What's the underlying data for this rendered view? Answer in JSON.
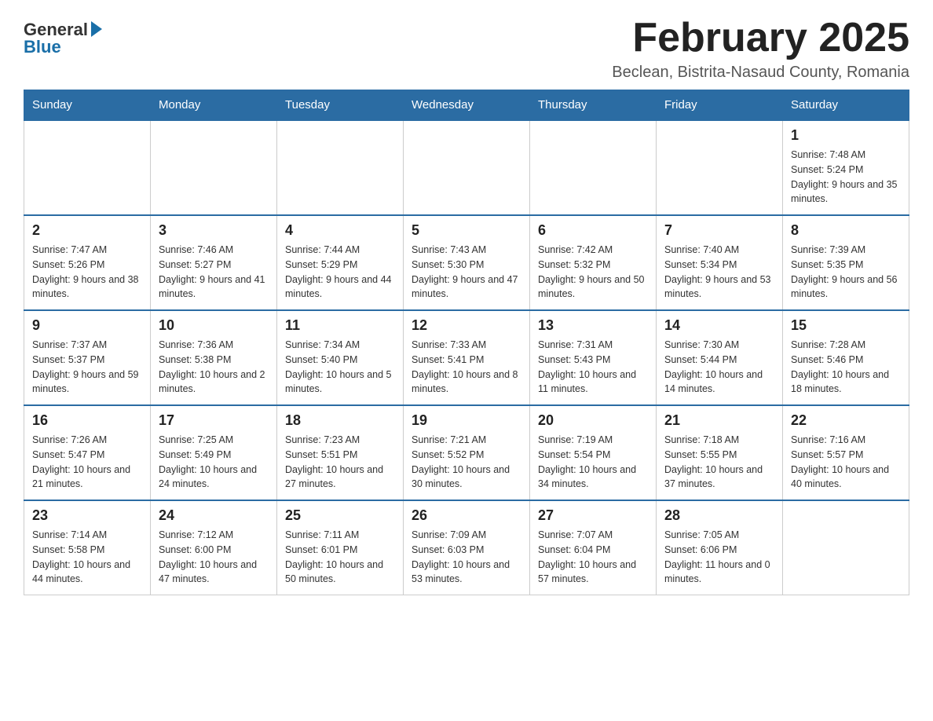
{
  "header": {
    "logo_general": "General",
    "logo_blue": "Blue",
    "month_title": "February 2025",
    "location": "Beclean, Bistrita-Nasaud County, Romania"
  },
  "days_of_week": [
    "Sunday",
    "Monday",
    "Tuesday",
    "Wednesday",
    "Thursday",
    "Friday",
    "Saturday"
  ],
  "weeks": [
    [
      {
        "day": "",
        "info": ""
      },
      {
        "day": "",
        "info": ""
      },
      {
        "day": "",
        "info": ""
      },
      {
        "day": "",
        "info": ""
      },
      {
        "day": "",
        "info": ""
      },
      {
        "day": "",
        "info": ""
      },
      {
        "day": "1",
        "info": "Sunrise: 7:48 AM\nSunset: 5:24 PM\nDaylight: 9 hours and 35 minutes."
      }
    ],
    [
      {
        "day": "2",
        "info": "Sunrise: 7:47 AM\nSunset: 5:26 PM\nDaylight: 9 hours and 38 minutes."
      },
      {
        "day": "3",
        "info": "Sunrise: 7:46 AM\nSunset: 5:27 PM\nDaylight: 9 hours and 41 minutes."
      },
      {
        "day": "4",
        "info": "Sunrise: 7:44 AM\nSunset: 5:29 PM\nDaylight: 9 hours and 44 minutes."
      },
      {
        "day": "5",
        "info": "Sunrise: 7:43 AM\nSunset: 5:30 PM\nDaylight: 9 hours and 47 minutes."
      },
      {
        "day": "6",
        "info": "Sunrise: 7:42 AM\nSunset: 5:32 PM\nDaylight: 9 hours and 50 minutes."
      },
      {
        "day": "7",
        "info": "Sunrise: 7:40 AM\nSunset: 5:34 PM\nDaylight: 9 hours and 53 minutes."
      },
      {
        "day": "8",
        "info": "Sunrise: 7:39 AM\nSunset: 5:35 PM\nDaylight: 9 hours and 56 minutes."
      }
    ],
    [
      {
        "day": "9",
        "info": "Sunrise: 7:37 AM\nSunset: 5:37 PM\nDaylight: 9 hours and 59 minutes."
      },
      {
        "day": "10",
        "info": "Sunrise: 7:36 AM\nSunset: 5:38 PM\nDaylight: 10 hours and 2 minutes."
      },
      {
        "day": "11",
        "info": "Sunrise: 7:34 AM\nSunset: 5:40 PM\nDaylight: 10 hours and 5 minutes."
      },
      {
        "day": "12",
        "info": "Sunrise: 7:33 AM\nSunset: 5:41 PM\nDaylight: 10 hours and 8 minutes."
      },
      {
        "day": "13",
        "info": "Sunrise: 7:31 AM\nSunset: 5:43 PM\nDaylight: 10 hours and 11 minutes."
      },
      {
        "day": "14",
        "info": "Sunrise: 7:30 AM\nSunset: 5:44 PM\nDaylight: 10 hours and 14 minutes."
      },
      {
        "day": "15",
        "info": "Sunrise: 7:28 AM\nSunset: 5:46 PM\nDaylight: 10 hours and 18 minutes."
      }
    ],
    [
      {
        "day": "16",
        "info": "Sunrise: 7:26 AM\nSunset: 5:47 PM\nDaylight: 10 hours and 21 minutes."
      },
      {
        "day": "17",
        "info": "Sunrise: 7:25 AM\nSunset: 5:49 PM\nDaylight: 10 hours and 24 minutes."
      },
      {
        "day": "18",
        "info": "Sunrise: 7:23 AM\nSunset: 5:51 PM\nDaylight: 10 hours and 27 minutes."
      },
      {
        "day": "19",
        "info": "Sunrise: 7:21 AM\nSunset: 5:52 PM\nDaylight: 10 hours and 30 minutes."
      },
      {
        "day": "20",
        "info": "Sunrise: 7:19 AM\nSunset: 5:54 PM\nDaylight: 10 hours and 34 minutes."
      },
      {
        "day": "21",
        "info": "Sunrise: 7:18 AM\nSunset: 5:55 PM\nDaylight: 10 hours and 37 minutes."
      },
      {
        "day": "22",
        "info": "Sunrise: 7:16 AM\nSunset: 5:57 PM\nDaylight: 10 hours and 40 minutes."
      }
    ],
    [
      {
        "day": "23",
        "info": "Sunrise: 7:14 AM\nSunset: 5:58 PM\nDaylight: 10 hours and 44 minutes."
      },
      {
        "day": "24",
        "info": "Sunrise: 7:12 AM\nSunset: 6:00 PM\nDaylight: 10 hours and 47 minutes."
      },
      {
        "day": "25",
        "info": "Sunrise: 7:11 AM\nSunset: 6:01 PM\nDaylight: 10 hours and 50 minutes."
      },
      {
        "day": "26",
        "info": "Sunrise: 7:09 AM\nSunset: 6:03 PM\nDaylight: 10 hours and 53 minutes."
      },
      {
        "day": "27",
        "info": "Sunrise: 7:07 AM\nSunset: 6:04 PM\nDaylight: 10 hours and 57 minutes."
      },
      {
        "day": "28",
        "info": "Sunrise: 7:05 AM\nSunset: 6:06 PM\nDaylight: 11 hours and 0 minutes."
      },
      {
        "day": "",
        "info": ""
      }
    ]
  ]
}
